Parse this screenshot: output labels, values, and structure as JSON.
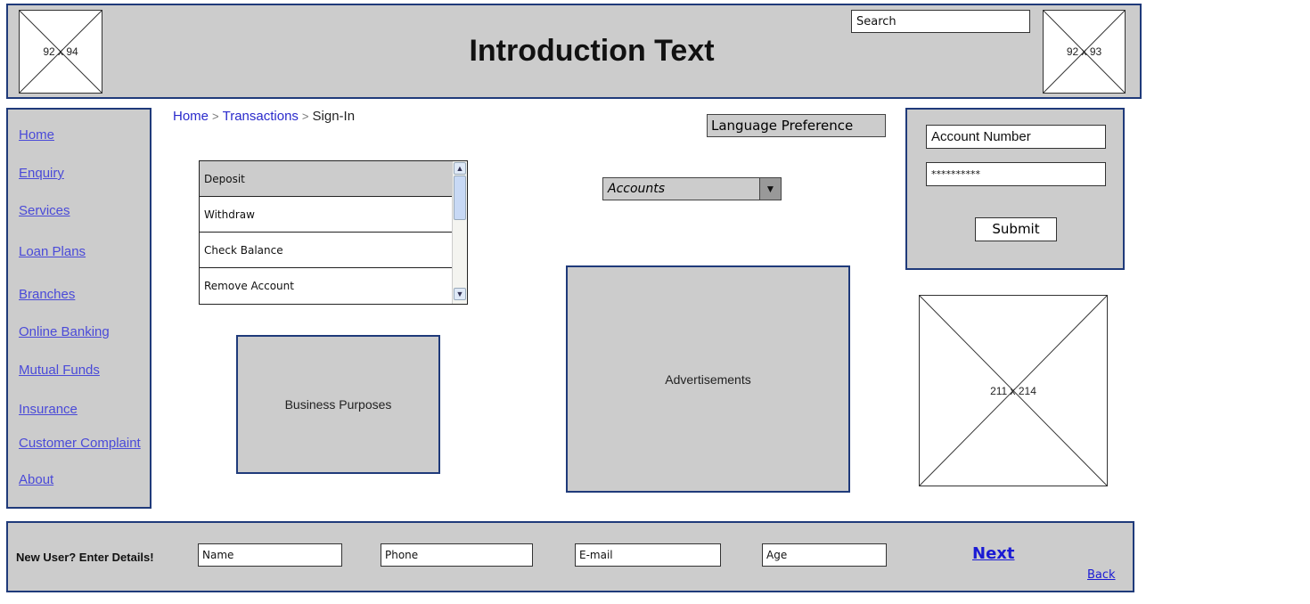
{
  "header": {
    "title": "Introduction Text",
    "search_placeholder": "Search",
    "left_image_label": "92 x 94",
    "right_image_label": "92 x 93"
  },
  "sidebar": {
    "items": [
      {
        "label": "Home"
      },
      {
        "label": "Enquiry"
      },
      {
        "label": "Services"
      },
      {
        "label": "Loan Plans"
      },
      {
        "label": "Branches"
      },
      {
        "label": "Online Banking"
      },
      {
        "label": "Mutual Funds"
      },
      {
        "label": "Insurance"
      },
      {
        "label": "Customer Complaint"
      },
      {
        "label": "About"
      }
    ]
  },
  "breadcrumb": {
    "items": [
      "Home",
      "Transactions",
      "Sign-In"
    ],
    "separator": ">"
  },
  "transactions_list": {
    "items": [
      "Deposit",
      "Withdraw",
      "Check Balance",
      "Remove Account"
    ],
    "selected": "Deposit"
  },
  "language_preference": {
    "label": "Language Preference"
  },
  "accounts_select": {
    "value": "Accounts",
    "arrow": "▼"
  },
  "login": {
    "account_number_placeholder": "Account Number",
    "password_value": "**********",
    "submit_label": "Submit"
  },
  "business_box": {
    "label": "Business Purposes"
  },
  "ads_box": {
    "label": "Advertisements"
  },
  "side_image": {
    "label": "211 x 214"
  },
  "footer": {
    "prompt": "New User? Enter Details!",
    "name_placeholder": "Name",
    "phone_placeholder": "Phone",
    "email_placeholder": "E-mail",
    "age_placeholder": "Age",
    "next_label": "Next",
    "back_label": "Back"
  },
  "colors": {
    "panel_bg": "#cccccc",
    "panel_border": "#1f3a7a",
    "link": "#4a4ad8"
  }
}
